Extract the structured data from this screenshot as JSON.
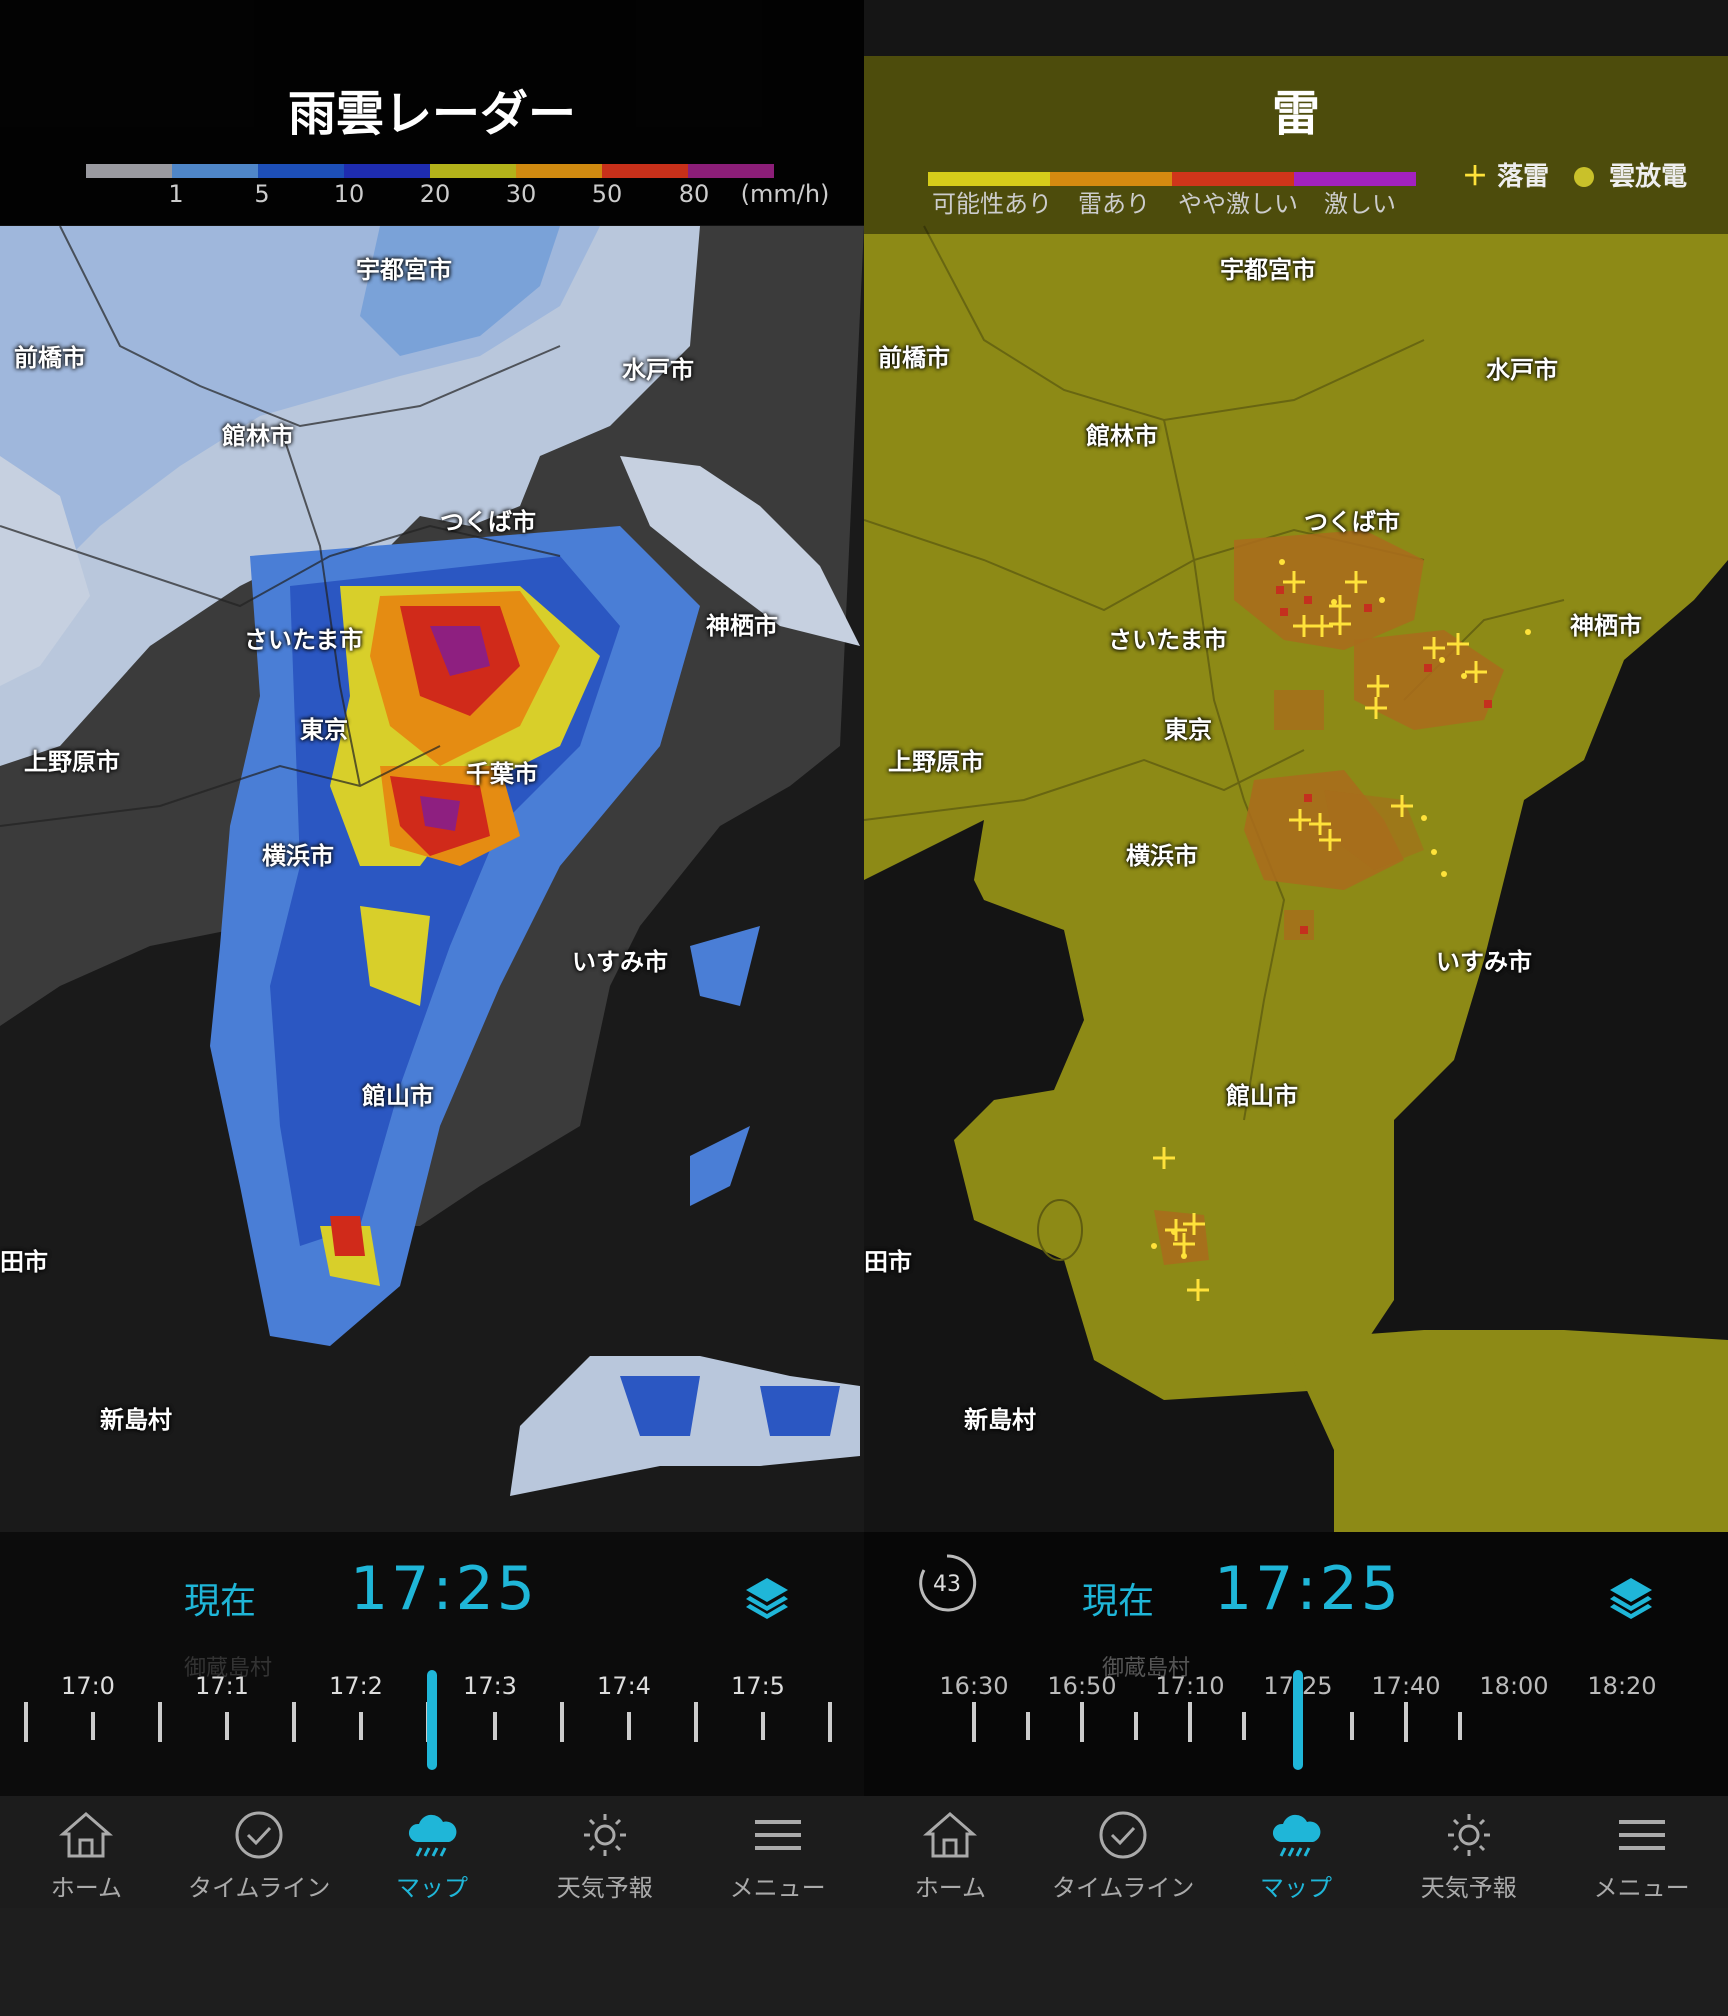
{
  "left": {
    "title": "雨雲レーダー",
    "scale_colors": [
      "#9a9aa0",
      "#4f86c8",
      "#1d4fb8",
      "#1e2cb0",
      "#b3b21a",
      "#d08a10",
      "#c8301a",
      "#8c1e78"
    ],
    "scale_labels": [
      "1",
      "5",
      "10",
      "20",
      "30",
      "50",
      "80",
      "(mm/h)"
    ],
    "cities": [
      "宇都宮市",
      "前橋市",
      "水戸市",
      "館林市",
      "つくば市",
      "さいたま市",
      "神栖市",
      "東京",
      "上野原市",
      "千葉市",
      "横浜市",
      "いすみ市",
      "館山市",
      "田市",
      "新島村"
    ],
    "bottom": {
      "now_label": "現在",
      "time": "17:25",
      "ticks": [
        "17:0",
        "17:1",
        "17:2",
        "17:3",
        "17:4",
        "17:5"
      ],
      "ghost_label": "御蔵島村"
    }
  },
  "right": {
    "title": "雷",
    "scale_colors": [
      "#d6cc1a",
      "#d58a10",
      "#d0351a",
      "#a321c0"
    ],
    "scale_labels": [
      "可能性あり",
      "雷あり",
      "やや激しい",
      "激しい"
    ],
    "legend": {
      "strike": "落雷",
      "cloud": "雲放電"
    },
    "cities": [
      "宇都宮市",
      "前橋市",
      "水戸市",
      "館林市",
      "つくば市",
      "さいたま市",
      "神栖市",
      "東京",
      "上野原市",
      "横浜市",
      "いすみ市",
      "館山市",
      "田市",
      "新島村"
    ],
    "bottom": {
      "timer_value": "43",
      "now_label": "現在",
      "time": "17:25",
      "ticks": [
        "16:30",
        "16:50",
        "17:10",
        "17:25",
        "17:40",
        "18:00",
        "18:20"
      ],
      "ghost_label": "御蔵島村"
    }
  },
  "nav": [
    "ホーム",
    "タイムライン",
    "マップ",
    "天気予報",
    "メニュー"
  ],
  "nav_active": 2,
  "colors": {
    "accent": "#1fb6d8",
    "lightning_area": "#8d8a16",
    "strike": "#ffe23a"
  }
}
